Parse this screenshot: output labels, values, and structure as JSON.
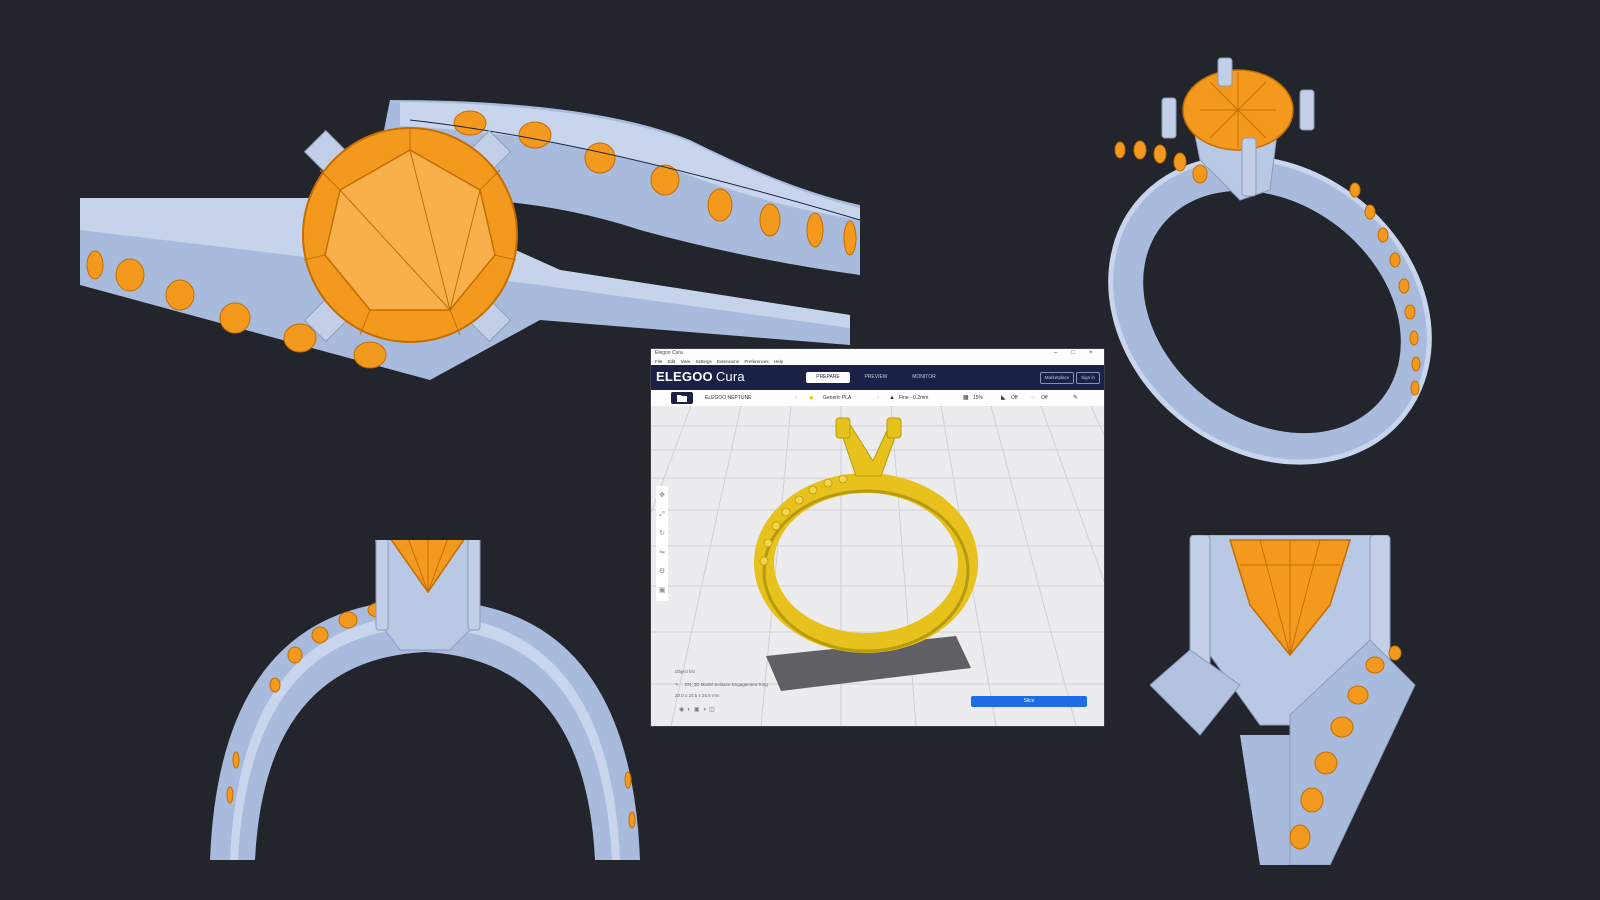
{
  "scene": {
    "background": "#23252d",
    "metal_color": "#a9bbdc",
    "gem_color": "#f39a1e"
  },
  "cura_window": {
    "title": "Elegoo Cura",
    "menu": [
      "File",
      "Edit",
      "View",
      "Settings",
      "Extensions",
      "Preferences",
      "Help"
    ],
    "logo_main": "ELEGOO",
    "logo_sub": "Cura",
    "stages": [
      "PREPARE",
      "PREVIEW",
      "MONITOR"
    ],
    "active_stage": "PREPARE",
    "header_buttons": [
      "Marketplace",
      "Sign in"
    ],
    "toolbar": {
      "printer": "ELEGOO NEPTUNE",
      "material": "Generic PLA",
      "profile": "Fine - 0.2mm",
      "infill": "15%",
      "support": "Off",
      "adhesion": "Off"
    },
    "side_tools": [
      "move",
      "scale",
      "rotate",
      "mirror",
      "per-model",
      "support-blocker"
    ],
    "object_list_label": "Object list",
    "object_name": "EN_3D Model Solitaire Engagement Ring",
    "object_size": "20.0 x 20.5 x 25.5 mm",
    "slice_button": "Slice",
    "model_color": "#e7c21d"
  }
}
